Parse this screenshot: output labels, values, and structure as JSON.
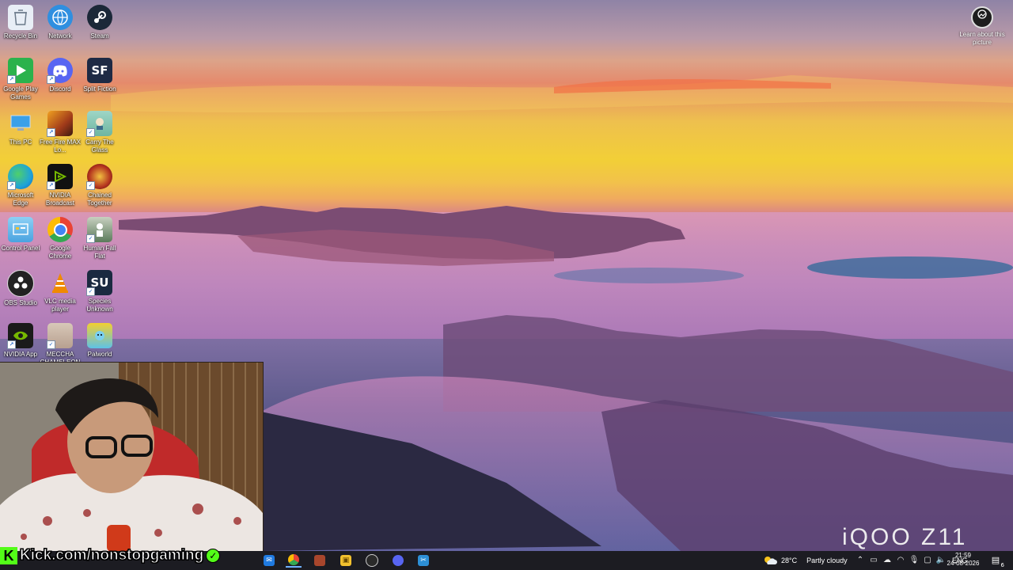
{
  "desktop_icons": [
    {
      "label": "Recycle Bin",
      "icon": "recycle-bin-icon",
      "color": "#e8eef6"
    },
    {
      "label": "Network",
      "icon": "network-icon",
      "color": "#2f8fe0"
    },
    {
      "label": "Steam",
      "icon": "steam-icon",
      "color": "#1b2838"
    },
    {
      "label": "Google Play Games",
      "icon": "google-play-games-icon",
      "color": "#2bb24c"
    },
    {
      "label": "Discord",
      "icon": "discord-icon",
      "color": "#5865f2"
    },
    {
      "label": "Split Fiction",
      "icon": "split-fiction-icon",
      "color": "#1e2a44",
      "text": "SF"
    },
    {
      "label": "This PC",
      "icon": "this-pc-icon",
      "color": "#3aa0e8"
    },
    {
      "label": "Free Fire MAX Lo...",
      "icon": "free-fire-icon",
      "color": "#a03a1a"
    },
    {
      "label": "Carry The Glass",
      "icon": "carry-the-glass-icon",
      "color": "#6fb6a0"
    },
    {
      "label": "Microsoft Edge",
      "icon": "edge-icon",
      "color": "#1fa3d8"
    },
    {
      "label": "NVIDIA Broadcast",
      "icon": "nvidia-broadcast-icon",
      "color": "#111111"
    },
    {
      "label": "Chained Together",
      "icon": "chained-together-icon",
      "color": "#b3321e"
    },
    {
      "label": "Control Panel",
      "icon": "control-panel-icon",
      "color": "#4aa3e0"
    },
    {
      "label": "Google Chrome",
      "icon": "chrome-icon",
      "color": "#e94335"
    },
    {
      "label": "Human Fall Flat",
      "icon": "human-fall-flat-icon",
      "color": "#5a7a5a"
    },
    {
      "label": "OBS Studio",
      "icon": "obs-studio-icon",
      "color": "#222222"
    },
    {
      "label": "VLC media player",
      "icon": "vlc-icon",
      "color": "#f08a00"
    },
    {
      "label": "Species Unknown",
      "icon": "species-unknown-icon",
      "color": "#1a2a40",
      "text": "SU"
    },
    {
      "label": "NVIDIA App",
      "icon": "nvidia-app-icon",
      "color": "#76b900"
    },
    {
      "label": "MECCHA CHAMELEON",
      "icon": "meccha-chameleon-icon",
      "color": "#b8a090"
    },
    {
      "label": "Palworld",
      "icon": "palworld-icon",
      "color": "#5ec2e6"
    }
  ],
  "learn_about": {
    "label": "Learn about this picture",
    "icon": "camera-icon"
  },
  "watermark": "iQOO Z11",
  "overlay": {
    "kick_text": "Kick.com/nonstopgaming",
    "kick_color": "#53fc18"
  },
  "taskbar": {
    "apps": [
      {
        "icon": "mail-icon",
        "color": "#1f7ae0",
        "active": false
      },
      {
        "icon": "chrome-icon",
        "color": "#e94335",
        "active": true
      },
      {
        "icon": "game-icon",
        "color": "#a8462c",
        "active": false
      },
      {
        "icon": "file-explorer-icon",
        "color": "#f2c12e",
        "active": false
      },
      {
        "icon": "obs-studio-icon",
        "color": "#2a2a2a",
        "active": false
      },
      {
        "icon": "discord-icon",
        "color": "#5865f2",
        "active": false
      },
      {
        "icon": "snipping-tool-icon",
        "color": "#2d8fd6",
        "active": false
      }
    ],
    "weather": {
      "temp": "28°C",
      "condition": "Partly cloudy",
      "icon": "partly-cloudy-icon"
    },
    "tray_icons": [
      "chevron-up-icon",
      "monitor-icon",
      "onedrive-icon",
      "wifi-icon",
      "microphone-icon",
      "display-icon",
      "speaker-icon"
    ],
    "language": "ENG",
    "time": "21:59",
    "date": "24-08-2026",
    "notification_badge": "6",
    "notification_icon": "notification-icon"
  }
}
